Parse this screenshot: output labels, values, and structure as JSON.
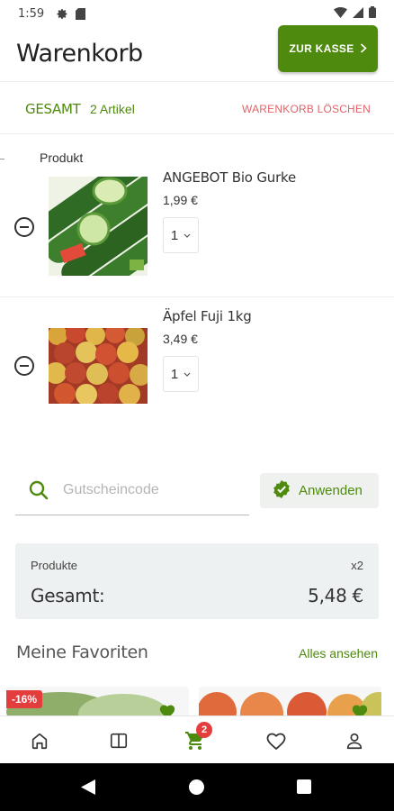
{
  "status_bar": {
    "time": "1:59"
  },
  "header": {
    "title": "Warenkorb",
    "checkout_label": "ZUR KASSE"
  },
  "cart_summary": {
    "total_label": "GESAMT",
    "count": "2 Artikel",
    "clear_label": "WARENKORB LÖSCHEN"
  },
  "columns": {
    "product": "Produkt"
  },
  "items": [
    {
      "name": "ANGEBOT Bio Gurke",
      "price": "1,99 €",
      "qty": "1"
    },
    {
      "name": "Äpfel Fuji 1kg",
      "price": "3,49 €",
      "qty": "1"
    }
  ],
  "coupon": {
    "placeholder": "Gutscheincode",
    "apply_label": "Anwenden"
  },
  "totals": {
    "products_label": "Produkte",
    "products_count": "x2",
    "total_label": "Gesamt:",
    "total_value": "5,48 €"
  },
  "favorites": {
    "title": "Meine Favoriten",
    "see_all": "Alles ansehen",
    "discount_badge": "-16%"
  },
  "bottom_nav": {
    "cart_badge": "2"
  },
  "colors": {
    "primary": "#4e8a0d",
    "danger": "#e0636a",
    "badge": "#e33d3d"
  }
}
